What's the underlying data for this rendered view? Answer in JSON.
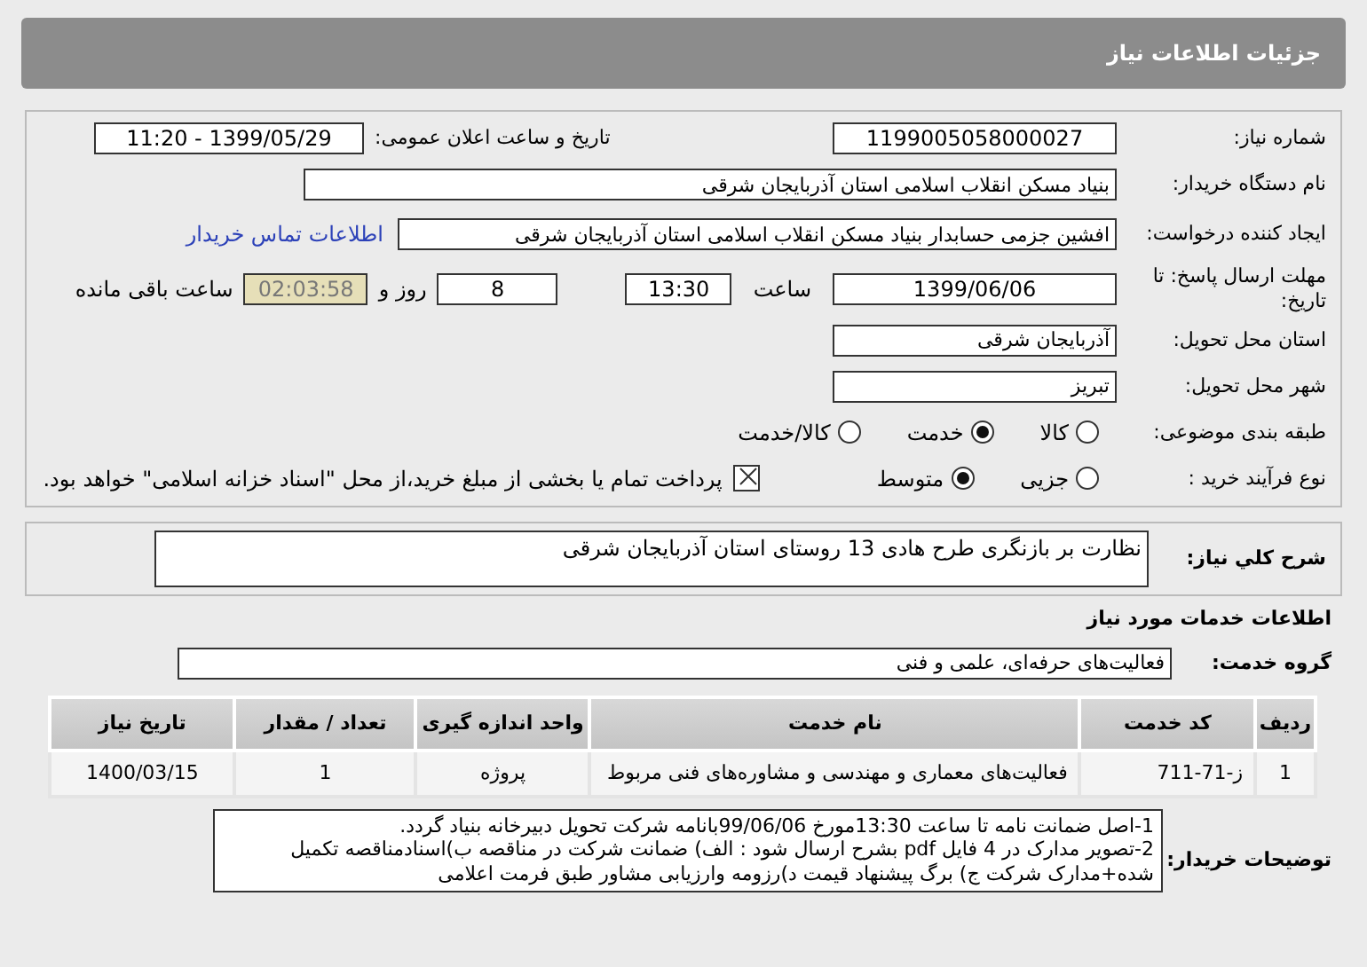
{
  "header": {
    "title": "جزئیات اطلاعات نیاز"
  },
  "need_number": {
    "label": "شماره نیاز:",
    "value": "1199005058000027"
  },
  "announce_date": {
    "label": "تاریخ و ساعت اعلان عمومی:",
    "value": "1399/05/29 - 11:20"
  },
  "buyer_org": {
    "label": "نام دستگاه خریدار:",
    "value": "بنیاد مسکن انقلاب اسلامی استان آذربایجان شرقی"
  },
  "requester": {
    "label": "ایجاد کننده درخواست:",
    "value": "افشین جزمی حسابدار بنیاد مسکن انقلاب اسلامی استان آذربایجان شرقی",
    "link": "اطلاعات تماس خریدار"
  },
  "deadline": {
    "label": "مهلت ارسال پاسخ: تا تاریخ:",
    "date": "1399/06/06",
    "time_label": "ساعت",
    "time": "13:30",
    "days": "8",
    "days_label": "روز و",
    "remaining": "02:03:58",
    "remaining_label": "ساعت باقی مانده"
  },
  "province": {
    "label": "استان محل تحویل:",
    "value": "آذربایجان شرقی"
  },
  "city": {
    "label": "شهر محل تحویل:",
    "value": "تبریز"
  },
  "category": {
    "label": "طبقه بندی موضوعی:",
    "options": [
      {
        "label": "کالا",
        "selected": false
      },
      {
        "label": "خدمت",
        "selected": true
      },
      {
        "label": "کالا/خدمت",
        "selected": false
      }
    ]
  },
  "process": {
    "label": "نوع فرآیند خرید :",
    "options": [
      {
        "label": "جزیی",
        "selected": false
      },
      {
        "label": "متوسط",
        "selected": true
      }
    ],
    "payment": {
      "checked": true,
      "text": "پرداخت تمام یا بخشی از مبلغ خرید،از محل \"اسناد خزانه اسلامی\" خواهد بود."
    }
  },
  "summary": {
    "label": "شرح کلي نياز:",
    "value": "نظارت بر بازنگری طرح هادی 13 روستای استان آذربایجان شرقی"
  },
  "services_heading": "اطلاعات خدمات مورد نیاز",
  "service_group": {
    "label": "گروه خدمت:",
    "value": "فعالیت‌های حرفه‌ای، علمی و فنی"
  },
  "table": {
    "columns": [
      "ردیف",
      "کد خدمت",
      "نام خدمت",
      "واحد اندازه گیری",
      "تعداد / مقدار",
      "تاریخ نیاز"
    ],
    "rows": [
      [
        "1",
        "ز-71-711",
        "فعالیت‌های معماری و مهندسی و مشاوره‌های فنی مربوط",
        "پروژه",
        "1",
        "1400/03/15"
      ]
    ]
  },
  "buyer_notes": {
    "label": "توضیحات خریدار:",
    "lines": [
      "1-اصل ضمانت نامه تا ساعت 13:30مورخ 99/06/06بانامه شرکت تحویل دبیرخانه بنیاد گردد.",
      "2-تصویر مدارک در 4 فایل pdf بشرح ارسال شود : الف) ضمانت شرکت در مناقصه ب)اسنادمناقصه تکمیل شده+مدارک شرکت ج) برگ پیشنهاد قیمت  د)رزومه وارزیابی مشاور طبق فرمت اعلامی"
    ]
  }
}
